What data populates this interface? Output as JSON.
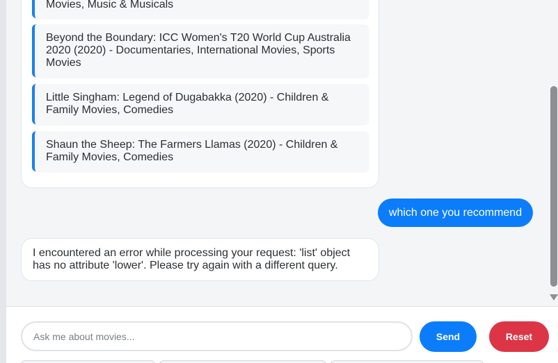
{
  "chat": {
    "movies": [
      {
        "text": "Movies, Music & Musicals"
      },
      {
        "text": "Beyond the Boundary: ICC Women's T20 World Cup Australia 2020 (2020) - Documentaries, International Movies, Sports Movies"
      },
      {
        "text": "Little Singham: Legend of Dugabakka (2020) - Children & Family Movies, Comedies"
      },
      {
        "text": "Shaun the Sheep: The Farmers Llamas (2020) - Children & Family Movies, Comedies"
      }
    ],
    "user_message": "which one you recommend",
    "bot_error": "I encountered an error while processing your request: 'list' object has no attribute 'lower'. Please try again with a different query."
  },
  "input": {
    "placeholder": "Ask me about movies...",
    "value": ""
  },
  "buttons": {
    "send_label": "Send",
    "reset_label": "Reset"
  },
  "colors": {
    "accent": "#0b7dfa",
    "danger": "#dc3545",
    "movie_border": "#1a7ff2"
  }
}
